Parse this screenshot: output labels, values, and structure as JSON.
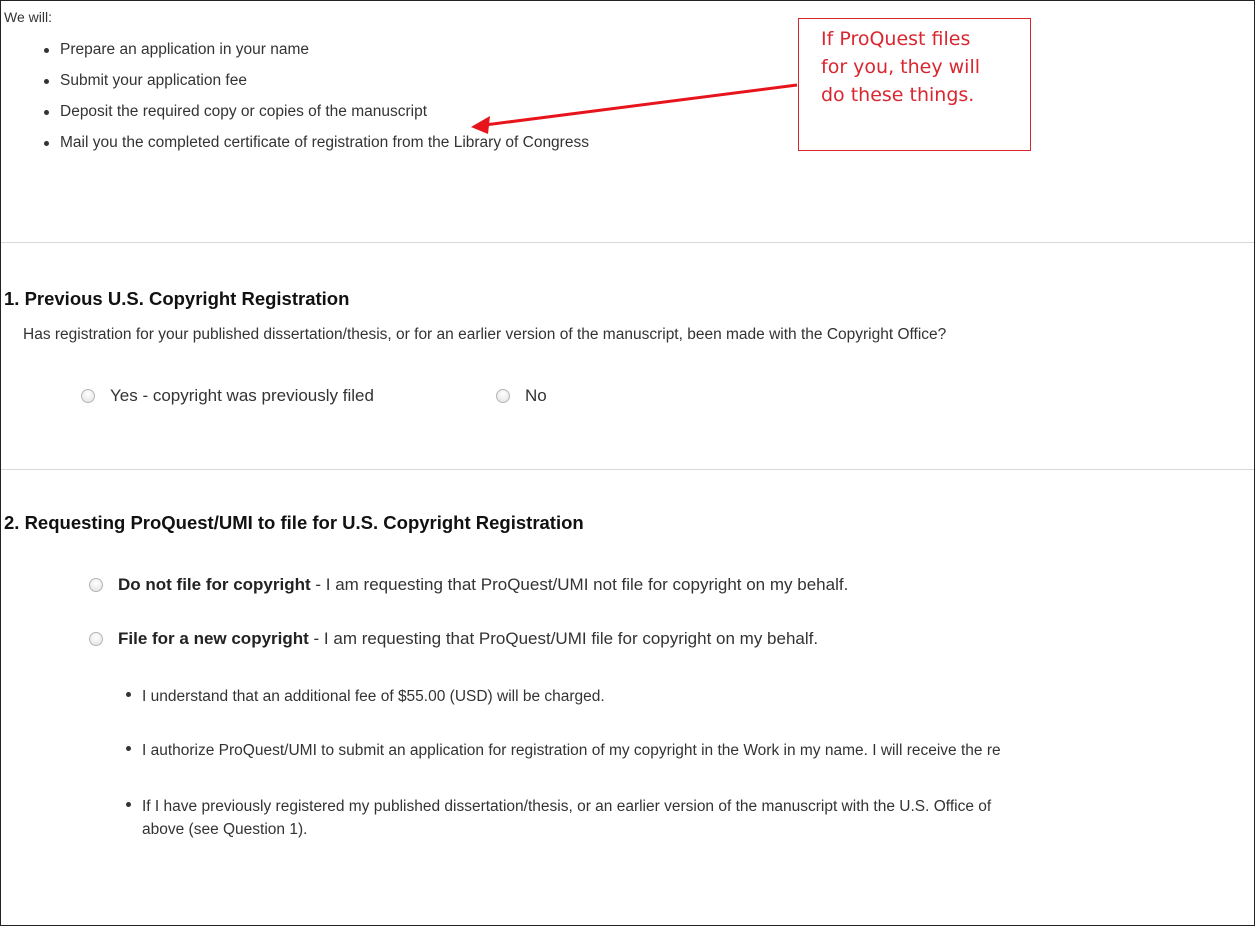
{
  "intro": "We will:",
  "we_will_items": [
    "Prepare an application in your name",
    "Submit your application fee",
    "Deposit the required copy or copies of the manuscript",
    "Mail you the completed certificate of registration from the Library of Congress"
  ],
  "callout": {
    "lines": [
      "If ProQuest files",
      "for you, they will",
      "do these things."
    ],
    "color": "#d9262f"
  },
  "section1": {
    "title": "1. Previous U.S. Copyright Registration",
    "question": "Has registration for your published dissertation/thesis, or for an earlier version of the manuscript, been made with the Copyright Office?",
    "options": [
      "Yes - copyright was previously filed",
      "No"
    ]
  },
  "section2": {
    "title": "2. Requesting ProQuest/UMI to file for U.S. Copyright Registration",
    "options": [
      {
        "bold": "Do not file for copyright",
        "rest": " - I am requesting that ProQuest/UMI not file for copyright on my behalf."
      },
      {
        "bold": "File for a new copyright",
        "rest": " - I am requesting that ProQuest/UMI file for copyright on my behalf."
      }
    ],
    "sub_items": [
      "I understand that an additional fee of $55.00 (USD) will be charged.",
      "I authorize ProQuest/UMI to submit an application for registration of my copyright in the Work in my name. I will receive the re",
      "If I have previously registered my published dissertation/thesis, or an earlier version of the manuscript with the U.S. Office of",
      "above (see Question 1)."
    ]
  }
}
